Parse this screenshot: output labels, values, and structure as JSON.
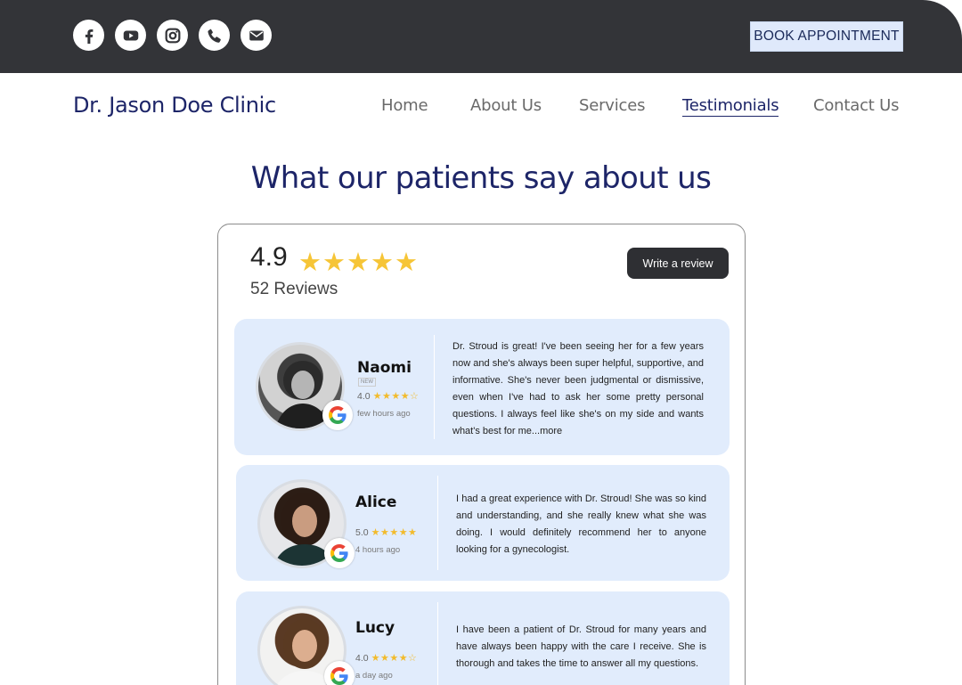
{
  "header": {
    "social": [
      {
        "name": "facebook-icon"
      },
      {
        "name": "youtube-icon"
      },
      {
        "name": "instagram-icon"
      },
      {
        "name": "phone-icon"
      },
      {
        "name": "email-icon"
      }
    ],
    "book_label": "BOOK APPOINTMENT"
  },
  "nav": {
    "brand": "Dr. Jason Doe Clinic",
    "items": [
      {
        "label": "Home"
      },
      {
        "label": "About Us"
      },
      {
        "label": "Services"
      },
      {
        "label": "Testimonials",
        "active": true
      },
      {
        "label": "Contact Us"
      }
    ]
  },
  "heading": "What our patients say about us",
  "summary": {
    "rating": "4.9",
    "stars": "★★★★★",
    "reviews": "52 Reviews",
    "write_label": "Write a review"
  },
  "reviews": [
    {
      "name": "Naomi",
      "badge": "NEW",
      "score": "4.0",
      "stars": "★★★★☆",
      "time": "few hours ago",
      "text": "Dr. Stroud is great! I've been seeing her for a few years now and she's always been super helpful, supportive, and informative. She's never been judgmental or dismissive, even when I've had to ask her some pretty personal questions. I always feel like she's on my side and wants what's best for me...more"
    },
    {
      "name": "Alice",
      "score": "5.0",
      "stars": "★★★★★",
      "time": "4 hours ago",
      "text": "I had a great experience with Dr. Stroud! She was so kind and understanding, and she really knew what she was doing. I would definitely recommend her to anyone looking for a gynecologist."
    },
    {
      "name": "Lucy",
      "score": "4.0",
      "stars": "★★★★☆",
      "time": "a day ago",
      "text": "I have been a patient of Dr. Stroud for many years and have always been happy with the care I receive. She is thorough and takes the time to answer all my questions."
    }
  ],
  "colors": {
    "topbar": "#333438",
    "brand": "#1d2568",
    "card": "#e1ecfc",
    "star": "#f6c537"
  }
}
